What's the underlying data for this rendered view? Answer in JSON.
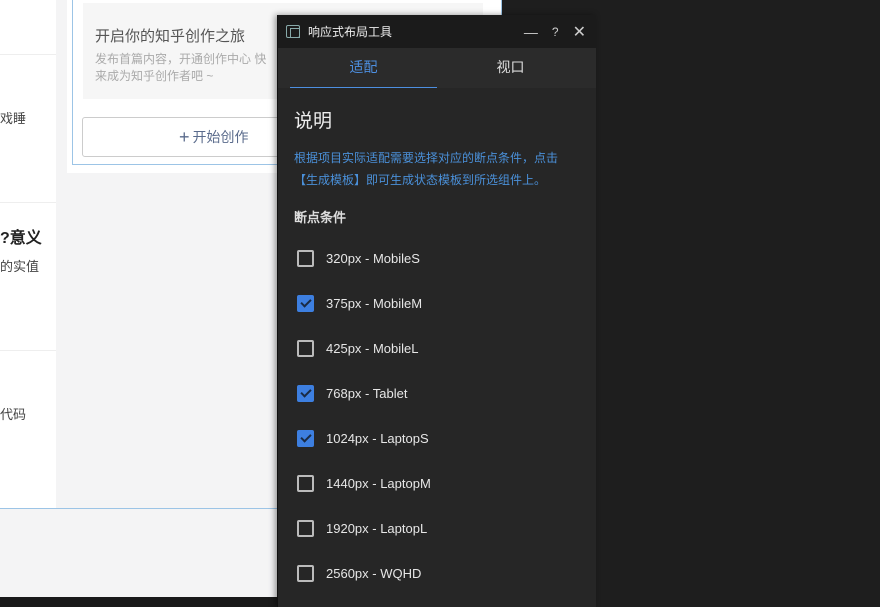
{
  "background_page": {
    "left_fragments": [
      "戏睡",
      "意义?",
      "的实值",
      "代码"
    ],
    "promo": {
      "title": "开启你的知乎创作之旅",
      "subtitle": "发布首篇内容，开通创作中心 快来成为知乎创作者吧 ~",
      "button": "开始创作"
    }
  },
  "dialog": {
    "title": "响应式布局工具",
    "controls": {
      "minimize": "—",
      "help": "?",
      "close": "✕"
    },
    "tabs": [
      {
        "label": "适配",
        "active": true
      },
      {
        "label": "视口",
        "active": false
      }
    ],
    "heading": "说明",
    "description": "根据项目实际适配需要选择对应的断点条件，点击【生成模板】即可生成状态模板到所选组件上。",
    "breakpoints_heading": "断点条件",
    "breakpoints": [
      {
        "label": "320px - MobileS",
        "checked": false
      },
      {
        "label": "375px - MobileM",
        "checked": true
      },
      {
        "label": "425px - MobileL",
        "checked": false
      },
      {
        "label": "768px - Tablet",
        "checked": true
      },
      {
        "label": "1024px - LaptopS",
        "checked": true
      },
      {
        "label": "1440px - LaptopM",
        "checked": false
      },
      {
        "label": "1920px - LaptopL",
        "checked": false
      },
      {
        "label": "2560px - WQHD",
        "checked": false
      }
    ],
    "accent_color": "#4d8fe0"
  }
}
